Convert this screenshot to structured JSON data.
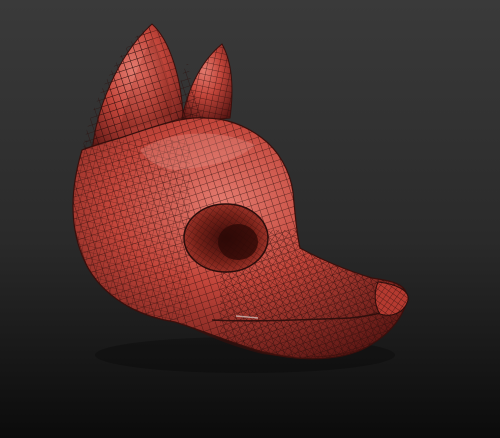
{
  "viewport": {
    "background_top": "#3a3a3a",
    "background_bottom": "#0b0b0b",
    "background_mid": "#2a2a2a"
  },
  "model": {
    "name": "fox-head-mask-wireframe",
    "shading": "wireframe-on-shaded",
    "base_color": "#c2453a",
    "highlight_color": "#e37a6e",
    "shadow_color": "#5a1613",
    "wire_color": "#2a0d0b"
  }
}
